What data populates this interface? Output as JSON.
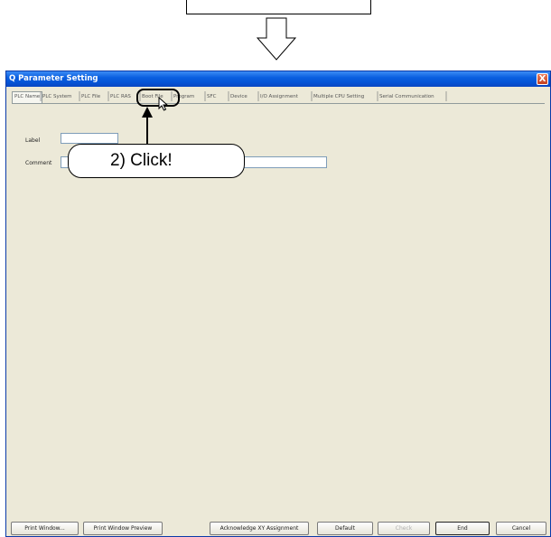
{
  "window": {
    "title": "Q Parameter Setting",
    "close_glyph": "X"
  },
  "tabs": [
    {
      "label": "PLC Name"
    },
    {
      "label": "PLC System"
    },
    {
      "label": "PLC File"
    },
    {
      "label": "PLC RAS"
    },
    {
      "label": "Boot File"
    },
    {
      "label": "Program"
    },
    {
      "label": "SFC"
    },
    {
      "label": "Device"
    },
    {
      "label": "I/O Assignment"
    },
    {
      "label": "Multiple CPU Setting"
    },
    {
      "label": "Serial Communication"
    }
  ],
  "form": {
    "label_text": "Label",
    "comment_text": "Comment",
    "label_value": "",
    "comment_value": ""
  },
  "callout": {
    "text": "2) Click!"
  },
  "buttons": {
    "print_window": "Print Window...",
    "print_preview": "Print Window Preview",
    "acknowledge": "Acknowledge XY Assignment",
    "default": "Default",
    "check": "Check",
    "end": "End",
    "cancel": "Cancel"
  },
  "icons": [
    "down-arrow-icon",
    "close-icon",
    "mouse-cursor-icon",
    "up-arrow-icon"
  ]
}
